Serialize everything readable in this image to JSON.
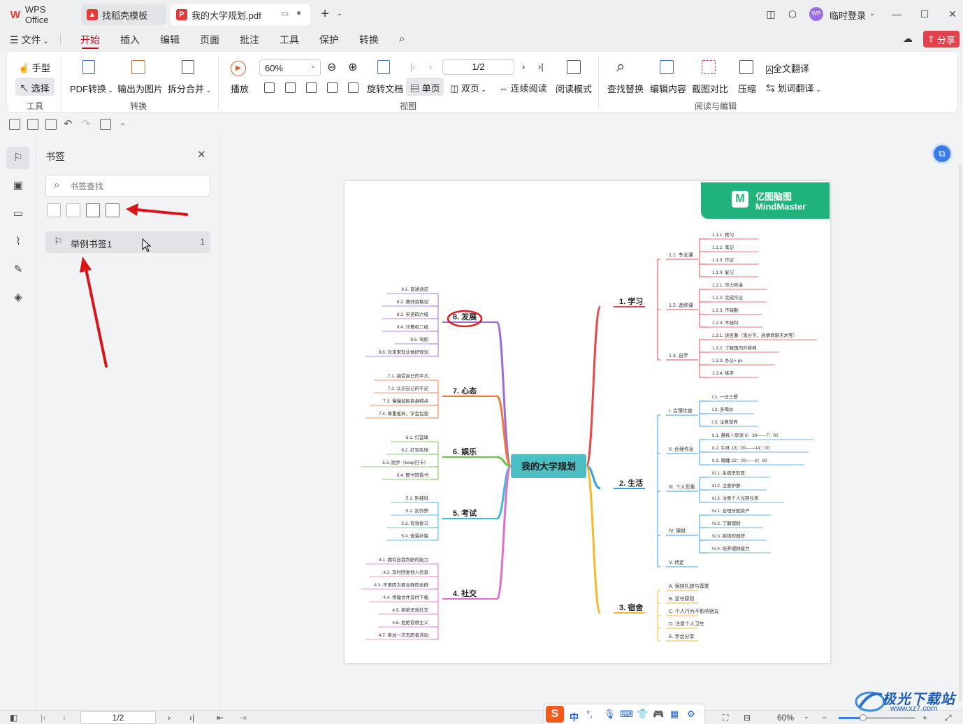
{
  "tabs": [
    {
      "label": "WPS Office"
    },
    {
      "label": "找稻壳模板"
    },
    {
      "label": "我的大学规划.pdf"
    }
  ],
  "titlebar": {
    "login": "临时登录",
    "avatar": "WP"
  },
  "menu": {
    "file": "文件",
    "items": [
      "开始",
      "插入",
      "编辑",
      "页面",
      "批注",
      "工具",
      "保护",
      "转换"
    ],
    "share": "分享"
  },
  "ribbon": {
    "hand": "手型",
    "select": "选择",
    "tools_group": "工具",
    "pdf_convert": "PDF转换",
    "export_image": "输出为图片",
    "split_merge": "拆分合并",
    "convert_group": "转换",
    "play": "播放",
    "zoom": "60%",
    "page_nav": "1/2",
    "rotate": "旋转文档",
    "single": "单页",
    "double": "双页",
    "continuous": "连续阅读",
    "read_mode": "阅读模式",
    "view_group": "视图",
    "find_replace": "查找替换",
    "edit_content": "编辑内容",
    "screenshot_compare": "截图对比",
    "compress": "压缩",
    "full_translate": "全文翻译",
    "word_translate": "划词翻译",
    "read_edit_group": "阅读与编辑"
  },
  "panel": {
    "title": "书签",
    "search_placeholder": "书签查找",
    "bookmarks": [
      {
        "label": "举例书签1",
        "page": "1"
      }
    ]
  },
  "mindmap": {
    "brand_cn": "亿图脑图",
    "brand_en": "MindMaster",
    "center": "我的大学规划",
    "right": [
      {
        "label": "1. 学习",
        "color": "#e8474c",
        "subs": [
          {
            "label": "1.1. 专业课",
            "leaves": [
              "1.1.1. 预习",
              "1.1.2. 笔记",
              "1.1.3. 作业",
              "1.1.4. 复习"
            ]
          },
          {
            "label": "1.2. 选修课",
            "leaves": [
              "1.2.1. 尽力听讲",
              "1.2.2. 完成作业",
              "1.2.3. 不缺勤",
              "1.2.4. 不挂科"
            ]
          },
          {
            "label": "1.3. 自学",
            "leaves": [
              "1.3.1. 读名著（鬼谷子，高情商聊天术等）",
              "1.3.2. 了解国内外新闻",
              "1.3.3. 办公+ ps",
              "1.3.4. 练字"
            ]
          }
        ]
      },
      {
        "label": "2. 生活",
        "color": "#3a9ee4",
        "subs": [
          {
            "label": "I. 合理饮食",
            "leaves": [
              "I.1. 一日三餐",
              "I.2. 多喝水",
              "I.3. 注意营养"
            ]
          },
          {
            "label": "II. 合理作息",
            "leaves": [
              "II.1. 晨练＋早读 6：30——7：00",
              "II.2. 午休 13：00——14：00",
              "II.3. 晚睡 22：00——6：60"
            ]
          },
          {
            "label": "III. 个人形象",
            "leaves": [
              "III.1. 生病早就医",
              "III.2. 注意护肤",
              "III.3. 注意个人仪容仪表"
            ]
          },
          {
            "label": "IV. 理财",
            "leaves": [
              "IV.1. 合理分配资产",
              "IV.2. 了解理财",
              "IV.3. 拒绝校园贷",
              "IV.4. 培养理财能力"
            ]
          },
          {
            "label": "V. 待定",
            "leaves": []
          }
        ]
      },
      {
        "label": "3. 宿舍",
        "color": "#f5b82e",
        "subs": [
          {
            "label": "A. 保持礼貌与尊重",
            "leaves": []
          },
          {
            "label": "B. 坚守原则",
            "leaves": []
          },
          {
            "label": "C. 个人行为不影响宿友",
            "leaves": []
          },
          {
            "label": "D. 注意个人卫生",
            "leaves": []
          },
          {
            "label": "E. 学会分享",
            "leaves": []
          }
        ]
      }
    ],
    "left": [
      {
        "label": "8. 发展",
        "color": "#9b6bd6",
        "leaves": [
          "8.1. 普通话证",
          "8.2. 教师资格证",
          "8.3. 英语四六级",
          "8.4. 计算机二级",
          "8.5. 驾照",
          "8.6. 对未来就业做好规划"
        ]
      },
      {
        "label": "7. 心态",
        "color": "#f0783c",
        "leaves": [
          "7.1. 接受自己的平凡",
          "7.2. 认识自己的不足",
          "7.3. 慢慢挖掘自身特点",
          "7.4. 尊重差异，学会包容"
        ]
      },
      {
        "label": "6. 娱乐",
        "color": "#6cc24a",
        "leaves": [
          "6.1. 打篮球",
          "6.2. 打羽毛球",
          "6.3. 跑步（keep打卡）",
          "6.4. 图书馆看书"
        ]
      },
      {
        "label": "5. 考试",
        "color": "#40b8d8",
        "leaves": [
          "5.1. 别挂科",
          "5.2. 别作弊",
          "5.3. 有效复习",
          "5.4. 查漏补缺"
        ]
      },
      {
        "label": "4. 社交",
        "color": "#e070c8",
        "leaves": [
          "4.1. 拥有自我判断的能力",
          "4.2. 及时回复他人信息",
          "4.3. 不要因为要合群而合群",
          "4.4. 传输文件及时下载",
          "4.5. 拒绝无效社交",
          "4.6. 拒绝官僚主义",
          "4.7. 参加一次志愿者活动"
        ]
      }
    ]
  },
  "statusbar": {
    "page": "1/2",
    "zoom": "60%",
    "ime": "中"
  },
  "watermark": "www.xz7.com"
}
